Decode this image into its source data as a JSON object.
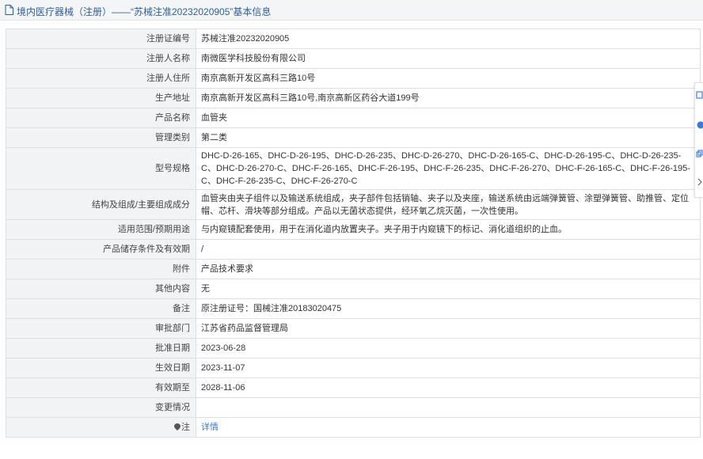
{
  "title": "境内医疗器械（注册）——“苏械注准20232020905”基本信息",
  "rows": [
    {
      "label": "注册证编号",
      "value": "苏械注准20232020905"
    },
    {
      "label": "注册人名称",
      "value": "南微医学科技股份有限公司"
    },
    {
      "label": "注册人住所",
      "value": "南京高新开发区高科三路10号"
    },
    {
      "label": "生产地址",
      "value": "南京高新开发区高科三路10号,南京高新区药谷大道199号"
    },
    {
      "label": "产品名称",
      "value": "血管夹"
    },
    {
      "label": "管理类别",
      "value": "第二类"
    },
    {
      "label": "型号规格",
      "value": "DHC-D-26-165、DHC-D-26-195、DHC-D-26-235、DHC-D-26-270、DHC-D-26-165-C、DHC-D-26-195-C、DHC-D-26-235-C、DHC-D-26-270-C、DHC-F-26-165、DHC-F-26-195、DHC-F-26-235、DHC-F-26-270、DHC-F-26-165-C、DHC-F-26-195-C、DHC-F-26-235-C、DHC-F-26-270-C"
    },
    {
      "label": "结构及组成/主要组成成分",
      "value": "血管夹由夹子组件以及输送系统组成，夹子部件包括销轴、夹子以及夹座，输送系统由远端弹簧管、涂塑弹簧管、助推管、定位帽、芯杆、滑块等部分组成。产品以无菌状态提供，经环氧乙烷灭菌，一次性使用。"
    },
    {
      "label": "适用范围/预期用途",
      "value": "与内窥镜配套使用，用于在消化道内放置夹子。夹子用于内窥镜下的标记、消化道组织的止血。"
    },
    {
      "label": "产品储存条件及有效期",
      "value": "/"
    },
    {
      "label": "附件",
      "value": "产品技术要求"
    },
    {
      "label": "其他内容",
      "value": "无"
    },
    {
      "label": "备注",
      "value": "原注册证号：国械注准20183020475"
    },
    {
      "label": "审批部门",
      "value": "江苏省药品监督管理局"
    },
    {
      "label": "批准日期",
      "value": "2023-06-28"
    },
    {
      "label": "生效日期",
      "value": "2023-11-07"
    },
    {
      "label": "有效期至",
      "value": "2028-11-06"
    },
    {
      "label": "变更情况",
      "value": ""
    },
    {
      "label": "注",
      "value": "详情"
    }
  ],
  "icons": {
    "title": "document-icon",
    "note": "pin-icon",
    "side": [
      "edit-icon",
      "help-icon",
      "copy-icon",
      "chevron-right-icon"
    ]
  },
  "colors": {
    "title": "#2d5f9a",
    "link": "#3c7bd3",
    "label_bg": "#f2f3f5",
    "border": "#dcdfe3"
  }
}
